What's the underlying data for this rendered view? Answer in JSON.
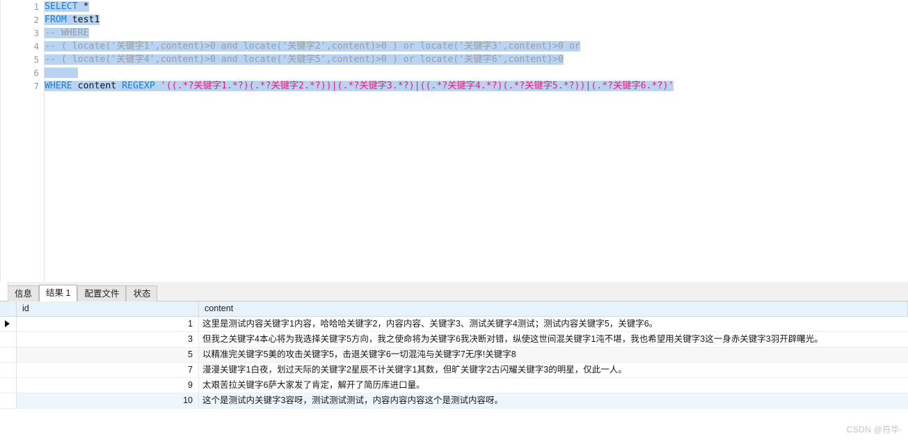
{
  "editor": {
    "line_numbers": [
      "1",
      "2",
      "3",
      "4",
      "5",
      "6",
      "7"
    ],
    "lines": [
      {
        "num": "1",
        "kw": "SELECT",
        "rest": " *",
        "type": "sql"
      },
      {
        "num": "2",
        "kw": "FROM",
        "rest": " test1",
        "type": "sql"
      },
      {
        "num": "3",
        "text": "-- WHERE",
        "type": "comment"
      },
      {
        "num": "4",
        "text": "-- ( locate('关键字1',content)>0 and locate('关键字2',content)>0 ) or locate('关键字3',content)>0 or",
        "type": "comment"
      },
      {
        "num": "5",
        "text": "-- ( locate('关键字4',content)>0 and locate('关键字5',content)>0 ) or locate('关键字6',content)>0",
        "type": "comment"
      },
      {
        "num": "6",
        "text": "",
        "type": "blank"
      },
      {
        "num": "7",
        "kw": "WHERE",
        "mid": " content ",
        "kw2": "REGEXP",
        "str": " '((.*?关键字1.*?)(.*?关键字2.*?))|(.*?关键字3.*?)|((.*?关键字4.*?)(.*?关键字5.*?))|(.*?关键字6.*?)'",
        "type": "sql-regexp"
      }
    ],
    "colors": {
      "keyword": "#1a7fd4",
      "comment": "#9d9d9d",
      "string": "#ec2075",
      "selection": "#b8d4f2",
      "gutter_text": "#9a9a9a"
    }
  },
  "bottom_panel": {
    "tabs": [
      {
        "label": "信息",
        "active": false
      },
      {
        "label": "结果 1",
        "active": true
      },
      {
        "label": "配置文件",
        "active": false
      },
      {
        "label": "状态",
        "active": false
      }
    ]
  },
  "result_grid": {
    "columns": [
      "id",
      "content"
    ],
    "rows": [
      {
        "id": "1",
        "content": "这里是测试内容关键字1内容，哈哈哈关键字2，内容内容、关键字3、测试关键字4测试；测试内容关键字5，关键字6。",
        "current": true,
        "style": "normal"
      },
      {
        "id": "3",
        "content": "但我之关键字4本心将为我选择关键字5方向，我之使命将为关键字6我决断对错，纵使这世间混关键字1沌不堪，我也希望用关键字3这一身赤关键字3羽开辟曙光。",
        "current": false,
        "style": "normal"
      },
      {
        "id": "5",
        "content": "以精准完关键字5美的攻击关键字5，击退关键字6一切混沌与关键字7无序!关键字8",
        "current": false,
        "style": "alt"
      },
      {
        "id": "7",
        "content": "漫漫关键字1白夜，划过天际的关键字2星辰不计关键字1其数，但旷关键字2古闪耀关键字3的明星，仅此一人。",
        "current": false,
        "style": "normal"
      },
      {
        "id": "9",
        "content": "太艰苦拉关键字6萨大家发了肯定，解开了简历库进口量。",
        "current": false,
        "style": "normal"
      },
      {
        "id": "10",
        "content": "这个是测试内关键字3容呀，测试测试测试，内容内容内容这个是测试内容呀。",
        "current": false,
        "style": "selected"
      }
    ]
  },
  "watermark": {
    "text": "CSDN @符华-"
  }
}
